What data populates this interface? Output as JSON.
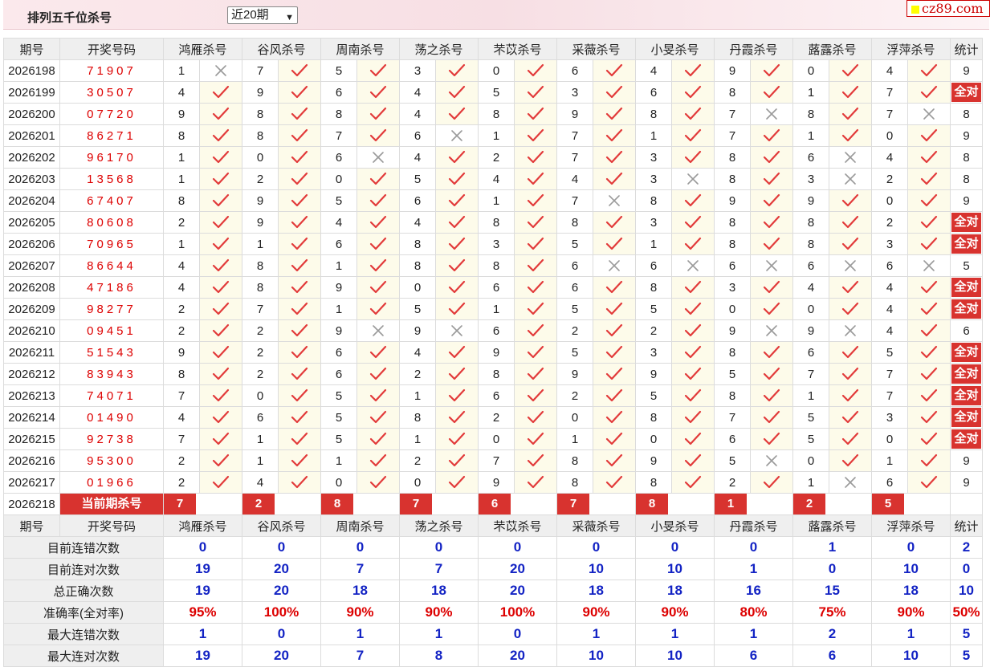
{
  "header": {
    "title": "排列五千位杀号",
    "period_select": "近20期",
    "logo": "cz89.com"
  },
  "columns": {
    "period": "期号",
    "draw": "开奖号码",
    "stat": "统计",
    "experts": [
      "鸿雁杀号",
      "谷风杀号",
      "周南杀号",
      "荡之杀号",
      "芣苡杀号",
      "采薇杀号",
      "小旻杀号",
      "丹霞杀号",
      "蕗露杀号",
      "浮萍杀号"
    ]
  },
  "rows": [
    {
      "period": "2026198",
      "draw": "71907",
      "kills": [
        "1",
        "7",
        "5",
        "3",
        "0",
        "6",
        "4",
        "9",
        "0",
        "4"
      ],
      "ok": [
        0,
        1,
        1,
        1,
        1,
        1,
        1,
        1,
        1,
        1
      ],
      "stat": "9"
    },
    {
      "period": "2026199",
      "draw": "30507",
      "kills": [
        "4",
        "9",
        "6",
        "4",
        "5",
        "3",
        "6",
        "8",
        "1",
        "7"
      ],
      "ok": [
        1,
        1,
        1,
        1,
        1,
        1,
        1,
        1,
        1,
        1
      ],
      "stat": "全对"
    },
    {
      "period": "2026200",
      "draw": "07720",
      "kills": [
        "9",
        "8",
        "8",
        "4",
        "8",
        "9",
        "8",
        "7",
        "8",
        "7"
      ],
      "ok": [
        1,
        1,
        1,
        1,
        1,
        1,
        1,
        0,
        1,
        0
      ],
      "stat": "8"
    },
    {
      "period": "2026201",
      "draw": "86271",
      "kills": [
        "8",
        "8",
        "7",
        "6",
        "1",
        "7",
        "1",
        "7",
        "1",
        "0"
      ],
      "ok": [
        1,
        1,
        1,
        0,
        1,
        1,
        1,
        1,
        1,
        1
      ],
      "stat": "9"
    },
    {
      "period": "2026202",
      "draw": "96170",
      "kills": [
        "1",
        "0",
        "6",
        "4",
        "2",
        "7",
        "3",
        "8",
        "6",
        "4"
      ],
      "ok": [
        1,
        1,
        0,
        1,
        1,
        1,
        1,
        1,
        0,
        1
      ],
      "stat": "8"
    },
    {
      "period": "2026203",
      "draw": "13568",
      "kills": [
        "1",
        "2",
        "0",
        "5",
        "4",
        "4",
        "3",
        "8",
        "3",
        "2"
      ],
      "ok": [
        1,
        1,
        1,
        1,
        1,
        1,
        0,
        1,
        0,
        1
      ],
      "stat": "8"
    },
    {
      "period": "2026204",
      "draw": "67407",
      "kills": [
        "8",
        "9",
        "5",
        "6",
        "1",
        "7",
        "8",
        "9",
        "9",
        "0"
      ],
      "ok": [
        1,
        1,
        1,
        1,
        1,
        0,
        1,
        1,
        1,
        1
      ],
      "stat": "9"
    },
    {
      "period": "2026205",
      "draw": "80608",
      "kills": [
        "2",
        "9",
        "4",
        "4",
        "8",
        "8",
        "3",
        "8",
        "8",
        "2"
      ],
      "ok": [
        1,
        1,
        1,
        1,
        1,
        1,
        1,
        1,
        1,
        1
      ],
      "stat": "全对"
    },
    {
      "period": "2026206",
      "draw": "70965",
      "kills": [
        "1",
        "1",
        "6",
        "8",
        "3",
        "5",
        "1",
        "8",
        "8",
        "3"
      ],
      "ok": [
        1,
        1,
        1,
        1,
        1,
        1,
        1,
        1,
        1,
        1
      ],
      "stat": "全对"
    },
    {
      "period": "2026207",
      "draw": "86644",
      "kills": [
        "4",
        "8",
        "1",
        "8",
        "8",
        "6",
        "6",
        "6",
        "6",
        "6"
      ],
      "ok": [
        1,
        1,
        1,
        1,
        1,
        0,
        0,
        0,
        0,
        0
      ],
      "stat": "5"
    },
    {
      "period": "2026208",
      "draw": "47186",
      "kills": [
        "4",
        "8",
        "9",
        "0",
        "6",
        "6",
        "8",
        "3",
        "4",
        "4"
      ],
      "ok": [
        1,
        1,
        1,
        1,
        1,
        1,
        1,
        1,
        1,
        1
      ],
      "stat": "全对"
    },
    {
      "period": "2026209",
      "draw": "98277",
      "kills": [
        "2",
        "7",
        "1",
        "5",
        "1",
        "5",
        "5",
        "0",
        "0",
        "4"
      ],
      "ok": [
        1,
        1,
        1,
        1,
        1,
        1,
        1,
        1,
        1,
        1
      ],
      "stat": "全对"
    },
    {
      "period": "2026210",
      "draw": "09451",
      "kills": [
        "2",
        "2",
        "9",
        "9",
        "6",
        "2",
        "2",
        "9",
        "9",
        "4"
      ],
      "ok": [
        1,
        1,
        0,
        0,
        1,
        1,
        1,
        0,
        0,
        1
      ],
      "stat": "6"
    },
    {
      "period": "2026211",
      "draw": "51543",
      "kills": [
        "9",
        "2",
        "6",
        "4",
        "9",
        "5",
        "3",
        "8",
        "6",
        "5"
      ],
      "ok": [
        1,
        1,
        1,
        1,
        1,
        1,
        1,
        1,
        1,
        1
      ],
      "stat": "全对"
    },
    {
      "period": "2026212",
      "draw": "83943",
      "kills": [
        "8",
        "2",
        "6",
        "2",
        "8",
        "9",
        "9",
        "5",
        "7",
        "7"
      ],
      "ok": [
        1,
        1,
        1,
        1,
        1,
        1,
        1,
        1,
        1,
        1
      ],
      "stat": "全对"
    },
    {
      "period": "2026213",
      "draw": "74071",
      "kills": [
        "7",
        "0",
        "5",
        "1",
        "6",
        "2",
        "5",
        "8",
        "1",
        "7"
      ],
      "ok": [
        1,
        1,
        1,
        1,
        1,
        1,
        1,
        1,
        1,
        1
      ],
      "stat": "全对"
    },
    {
      "period": "2026214",
      "draw": "01490",
      "kills": [
        "4",
        "6",
        "5",
        "8",
        "2",
        "0",
        "8",
        "7",
        "5",
        "3"
      ],
      "ok": [
        1,
        1,
        1,
        1,
        1,
        1,
        1,
        1,
        1,
        1
      ],
      "stat": "全对"
    },
    {
      "period": "2026215",
      "draw": "92738",
      "kills": [
        "7",
        "1",
        "5",
        "1",
        "0",
        "1",
        "0",
        "6",
        "5",
        "0"
      ],
      "ok": [
        1,
        1,
        1,
        1,
        1,
        1,
        1,
        1,
        1,
        1
      ],
      "stat": "全对"
    },
    {
      "period": "2026216",
      "draw": "95300",
      "kills": [
        "2",
        "1",
        "1",
        "2",
        "7",
        "8",
        "9",
        "5",
        "0",
        "1"
      ],
      "ok": [
        1,
        1,
        1,
        1,
        1,
        1,
        1,
        0,
        1,
        1
      ],
      "stat": "9"
    },
    {
      "period": "2026217",
      "draw": "01966",
      "kills": [
        "2",
        "4",
        "0",
        "0",
        "9",
        "8",
        "8",
        "2",
        "1",
        "6"
      ],
      "ok": [
        1,
        1,
        1,
        1,
        1,
        1,
        1,
        1,
        0,
        1
      ],
      "stat": "9"
    }
  ],
  "current": {
    "period": "2026218",
    "label": "当前期杀号",
    "kills": [
      "7",
      "2",
      "8",
      "7",
      "6",
      "7",
      "8",
      "1",
      "2",
      "5"
    ]
  },
  "summary": [
    {
      "label": "目前连错次数",
      "values": [
        "0",
        "0",
        "0",
        "0",
        "0",
        "0",
        "0",
        "0",
        "1",
        "0"
      ],
      "stat": "2",
      "red": false
    },
    {
      "label": "目前连对次数",
      "values": [
        "19",
        "20",
        "7",
        "7",
        "20",
        "10",
        "10",
        "1",
        "0",
        "10"
      ],
      "stat": "0",
      "red": false
    },
    {
      "label": "总正确次数",
      "values": [
        "19",
        "20",
        "18",
        "18",
        "20",
        "18",
        "18",
        "16",
        "15",
        "18"
      ],
      "stat": "10",
      "red": false
    },
    {
      "label": "准确率(全对率)",
      "values": [
        "95%",
        "100%",
        "90%",
        "90%",
        "100%",
        "90%",
        "90%",
        "80%",
        "75%",
        "90%"
      ],
      "stat": "50%",
      "red": true
    },
    {
      "label": "最大连错次数",
      "values": [
        "1",
        "0",
        "1",
        "1",
        "0",
        "1",
        "1",
        "1",
        "2",
        "1"
      ],
      "stat": "5",
      "red": false
    },
    {
      "label": "最大连对次数",
      "values": [
        "19",
        "20",
        "7",
        "8",
        "20",
        "10",
        "10",
        "6",
        "6",
        "10"
      ],
      "stat": "5",
      "red": false
    }
  ],
  "icons": {
    "correct": "check-icon",
    "wrong": "cross-icon"
  },
  "colors": {
    "accent": "#d8332f",
    "summary_value": "#1323c4",
    "draw_number": "#dd0000"
  }
}
